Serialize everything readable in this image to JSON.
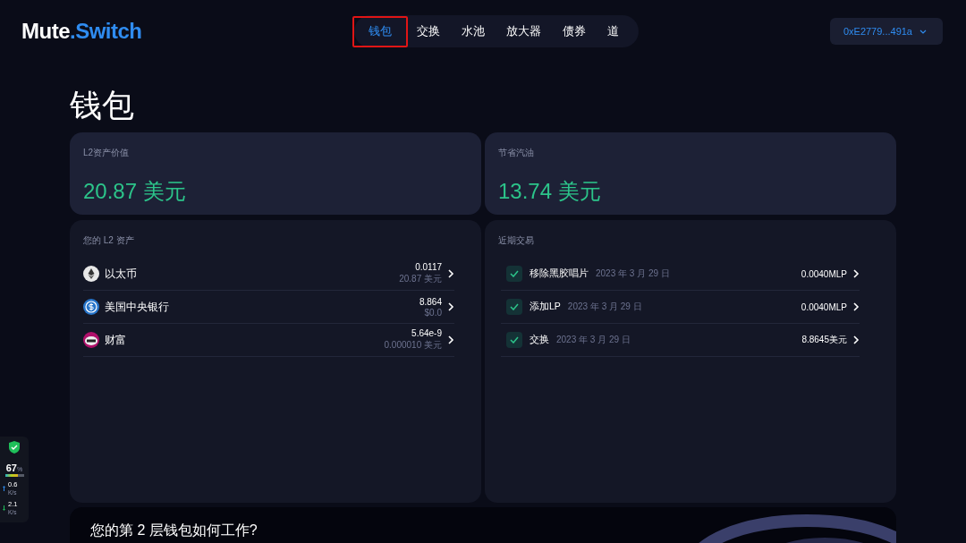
{
  "logo": {
    "part_1": "Mute",
    "part_2": ".Switch"
  },
  "nav": [
    {
      "label": "钱包",
      "selected": true,
      "highlighted": true
    },
    {
      "label": "交换",
      "selected": false,
      "highlighted": false
    },
    {
      "label": "水池",
      "selected": false,
      "highlighted": false
    },
    {
      "label": "放大器",
      "selected": false,
      "highlighted": false
    },
    {
      "label": "债券",
      "selected": false,
      "highlighted": false
    },
    {
      "label": "道",
      "selected": false,
      "highlighted": false
    }
  ],
  "account_button": {
    "label": "0xE2779...491a"
  },
  "page_title": "钱包",
  "summary_cards": [
    {
      "label": "L2资产价值",
      "value": "20.87 美元"
    },
    {
      "label": "节省汽油",
      "value": "13.74 美元"
    }
  ],
  "assets": {
    "title": "您的 L2 资产",
    "rows": [
      {
        "kind": "eth",
        "name": "以太币",
        "amount": "0.0117",
        "value": "20.87 美元"
      },
      {
        "kind": "usdc",
        "name": "美国中央银行",
        "amount": "8.864",
        "value": "$0.0"
      },
      {
        "kind": "mute",
        "name": "财富",
        "amount": "5.64e-9",
        "value": "0.000010 美元"
      }
    ]
  },
  "transactions": {
    "title": "近期交易",
    "rows": [
      {
        "name": "移除黑胶唱片",
        "date": "2023 年 3 月 29 日",
        "amount": "0.0040MLP",
        "done": true
      },
      {
        "name": "添加LP",
        "date": "2023 年 3 月 29 日",
        "amount": "0.0040MLP",
        "done": true
      },
      {
        "name": "交换",
        "date": "2023 年 3 月 29 日",
        "amount": "8.8645美元",
        "done": true
      }
    ]
  },
  "info_card": {
    "title": "您的第 2 层钱包如何工作?"
  },
  "monitor": {
    "percent": "67",
    "unit": "%",
    "level": 0.67,
    "upload": "0.6",
    "upload_unit": "K/s",
    "download": "2.1",
    "download_unit": "K/s"
  }
}
